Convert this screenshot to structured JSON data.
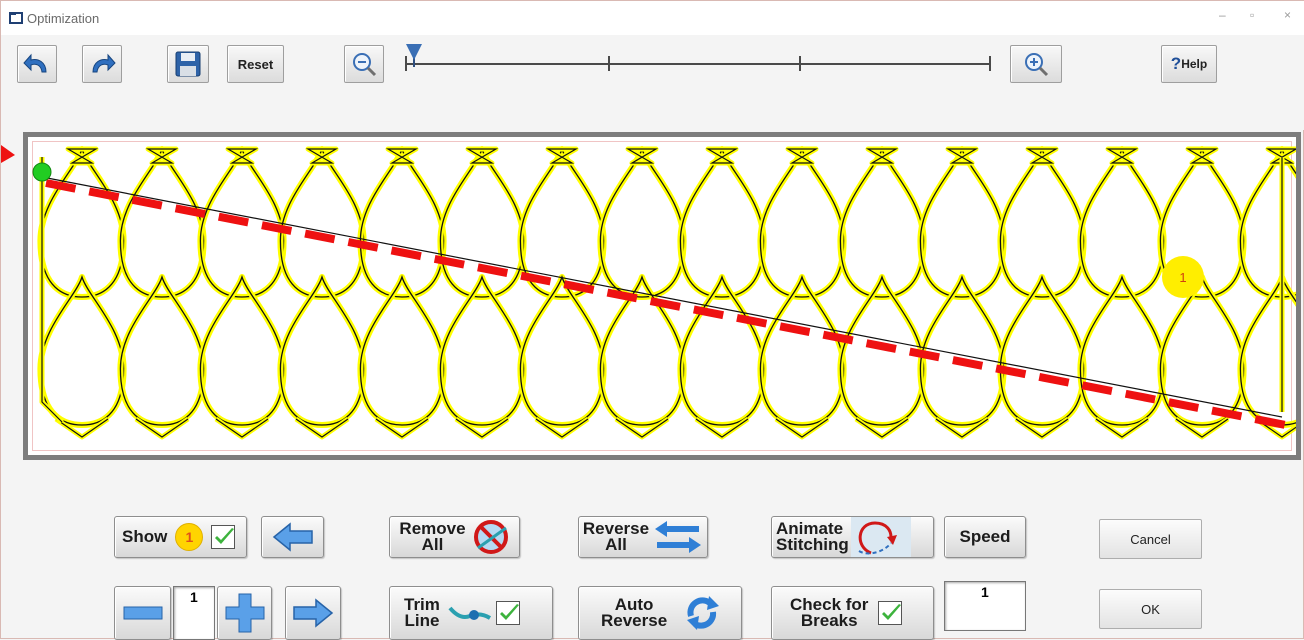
{
  "window": {
    "title": "Optimization",
    "minimize": "–",
    "maximize": "▫",
    "close": "×"
  },
  "toolbar": {
    "undo_icon": "undo-arrow-icon",
    "redo_icon": "redo-arrow-icon",
    "save_icon": "floppy-disk-icon",
    "reset_label": "Reset",
    "zoom_out_icon": "magnifier-minus-icon",
    "zoom_in_icon": "magnifier-plus-icon",
    "zoom_level": 0,
    "help_mark": "?",
    "help_label": "Help"
  },
  "canvas": {
    "marker_label": "1",
    "colors": {
      "pattern": "#ffff00",
      "outline": "#111111",
      "arrow": "#ee1111",
      "start": "#22cc22",
      "marker": "#ffee00"
    }
  },
  "controls": {
    "show_label": "Show",
    "show_badge": "1",
    "show_checked": true,
    "remove_all_line1": "Remove",
    "remove_all_line2": "All",
    "reverse_all_line1": "Reverse",
    "reverse_all_line2": "All",
    "animate_line1": "Animate",
    "animate_line2": "Stitching",
    "speed_label": "Speed",
    "cancel_label": "Cancel",
    "stepper_value": "1",
    "trim_line1": "Trim",
    "trim_line2": "Line",
    "trim_checked": true,
    "auto_reverse_line1": "Auto",
    "auto_reverse_line2": "Reverse",
    "check_breaks_line1": "Check for",
    "check_breaks_line2": "Breaks",
    "check_breaks_checked": true,
    "speed_value": "1",
    "ok_label": "OK"
  }
}
